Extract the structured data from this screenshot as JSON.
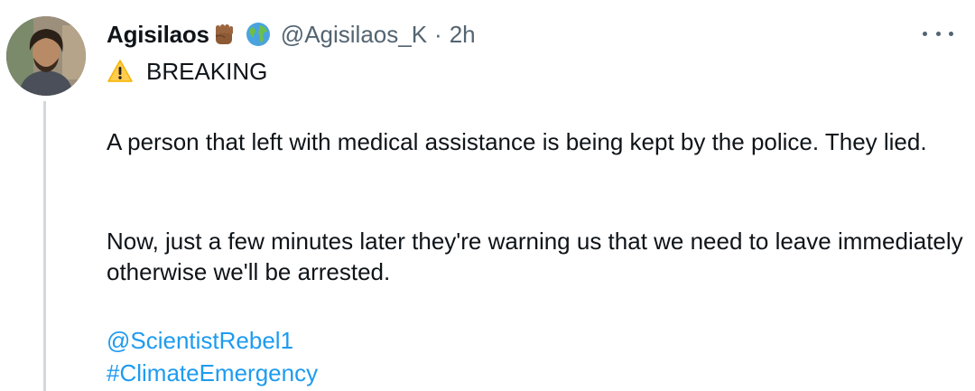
{
  "tweet": {
    "display_name": "Agisilaos",
    "handle": "@Agisilaos_K",
    "separator": "·",
    "time": "2h",
    "name_emoji_icons": [
      "raised-fist-icon",
      "globe-icon"
    ],
    "breaking_icon": "warning-icon",
    "breaking_text": "BREAKING",
    "paragraphs": [
      "A person that left with medical assistance is being kept by the police. They lied.",
      "Now, just a few minutes later they're warning us that we need to leave immediately otherwise we'll be arrested."
    ],
    "mention": "@ScientistRebel1",
    "hashtag": "#ClimateEmergency"
  },
  "colors": {
    "text": "#0f1419",
    "secondary": "#536471",
    "link": "#1d9bf0",
    "thread_line": "#cfd9de"
  }
}
